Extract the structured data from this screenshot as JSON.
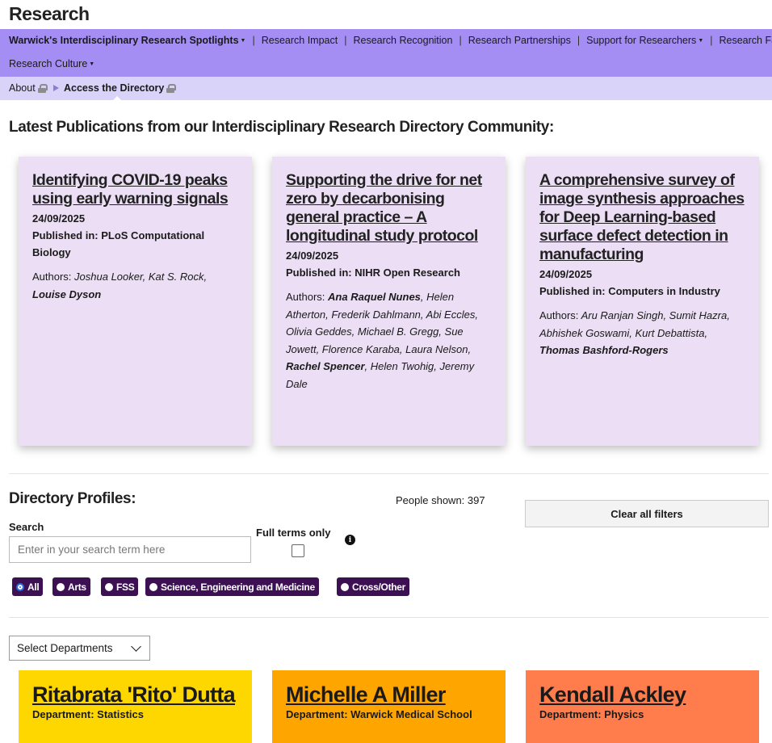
{
  "site_title": "Research",
  "nav": {
    "row1": [
      {
        "label": "Warwick's Interdisciplinary Research Spotlights",
        "dropdown": true
      },
      {
        "label": "Research Impact",
        "dropdown": false
      },
      {
        "label": "Research Recognition",
        "dropdown": false
      },
      {
        "label": "Research Partnerships",
        "dropdown": false
      },
      {
        "label": "Support for Researchers",
        "dropdown": true
      },
      {
        "label": "Research Facilities",
        "dropdown": false
      }
    ],
    "row2": [
      {
        "label": "Research Culture",
        "dropdown": true
      }
    ]
  },
  "breadcrumb": {
    "items": [
      "About",
      "Access the Directory"
    ]
  },
  "publications": {
    "heading": "Latest Publications from our Interdisciplinary Research Directory Community:",
    "cards": [
      {
        "title": "Identifying COVID-19 peaks using early warning signals",
        "date": "24/09/2025",
        "published_in": "Published in: PLoS Computational Biology",
        "authors_label": "Authors:",
        "authors": "Joshua Looker, Kat S. Rock,",
        "authors_bold": "Louise Dyson",
        "authors_after": "",
        "authors_bold2": "",
        "authors_end": ""
      },
      {
        "title": "Supporting the drive for net zero by decarbonising general practice – A longitudinal study protocol",
        "date": "24/09/2025",
        "published_in": "Published in: NIHR Open Research",
        "authors_label": "Authors:",
        "authors": "",
        "authors_bold": "Ana Raquel Nunes",
        "authors_after": ", Helen Atherton, Frederik Dahlmann, Abi Eccles, Olivia Geddes, Michael B. Gregg, Sue Jowett, Florence Karaba, Laura Nelson,",
        "authors_bold2": "Rachel Spencer",
        "authors_end": ", Helen Twohig, Jeremy Dale"
      },
      {
        "title": "A comprehensive survey of image synthesis approaches for Deep Learning-based surface defect detection in manufacturing",
        "date": "24/09/2025",
        "published_in": "Published in: Computers in Industry",
        "authors_label": "Authors:",
        "authors": "Aru Ranjan Singh, Sumit Hazra, Abhishek Goswami, Kurt Debattista,",
        "authors_bold": "Thomas Bashford-Rogers",
        "authors_after": "",
        "authors_bold2": "",
        "authors_end": ""
      }
    ]
  },
  "directory": {
    "heading": "Directory Profiles:",
    "people_shown": "People shown: 397",
    "clear_filters": "Clear all filters",
    "search_label": "Search",
    "search_placeholder": "Enter in your search term here",
    "full_terms_label": "Full terms only",
    "info_icon_glyph": "i",
    "faculty_filters": [
      {
        "label": "All",
        "selected": true
      },
      {
        "label": "Arts",
        "selected": false
      },
      {
        "label": "FSS",
        "selected": false
      },
      {
        "label": "Science, Engineering and Medicine",
        "selected": false
      },
      {
        "label": "Cross/Other",
        "selected": false
      }
    ],
    "departments_select": "Select Departments",
    "profiles": [
      {
        "name": "Ritabrata 'Rito' Dutta",
        "department": "Department: Statistics",
        "color": "#ffd700"
      },
      {
        "name": "Michelle A Miller",
        "department": "Department: Warwick Medical School",
        "color": "#ffa500"
      },
      {
        "name": "Kendall Ackley",
        "department": "Department: Physics",
        "color": "#ff7c4c"
      }
    ]
  },
  "colors": {
    "nav_bg": "#a58ef3",
    "breadcrumb_bg": "#d9d2f9",
    "pub_card_bg": "#ecdff5",
    "pill_bg": "#3c1053"
  }
}
